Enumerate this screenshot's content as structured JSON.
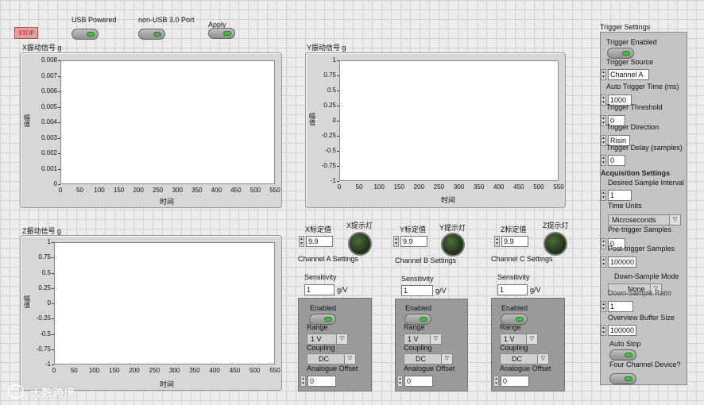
{
  "top": {
    "stop_label": "STOP",
    "usb_powered_label": "USB Powered",
    "non_usb_label": "non-USB 3.0 Port",
    "apply_label": "Apply"
  },
  "charts": {
    "x": {
      "title": "X振动信号 g",
      "ylabel": "幅值",
      "xlabel": "时间",
      "yticks": [
        "0.008",
        "0.007",
        "0.006",
        "0.005",
        "0.004",
        "0.003",
        "0.002",
        "0.001",
        "0"
      ],
      "xticks": [
        "0",
        "50",
        "100",
        "150",
        "200",
        "250",
        "300",
        "350",
        "400",
        "450",
        "500",
        "550"
      ]
    },
    "y": {
      "title": "Y振动信号 g",
      "ylabel": "幅值",
      "xlabel": "时间",
      "yticks": [
        "1",
        "0.75",
        "0.5",
        "0.25",
        "0",
        "-0.25",
        "-0.5",
        "-0.75",
        "-1"
      ],
      "xticks": [
        "0",
        "50",
        "100",
        "150",
        "200",
        "250",
        "300",
        "350",
        "400",
        "450",
        "500",
        "550"
      ]
    },
    "z": {
      "title": "Z振动信号 g",
      "ylabel": "幅值",
      "xlabel": "时间",
      "yticks": [
        "1",
        "0.75",
        "0.5",
        "0.25",
        "0",
        "-0.25",
        "-0.5",
        "-0.75",
        "-1"
      ],
      "xticks": [
        "0",
        "50",
        "100",
        "150",
        "200",
        "250",
        "300",
        "350",
        "400",
        "450",
        "500",
        "550"
      ]
    }
  },
  "chart_data": [
    {
      "type": "line",
      "title": "X振动信号 g",
      "xlabel": "时间",
      "ylabel": "幅值",
      "xlim": [
        0,
        550
      ],
      "ylim": [
        0,
        0.008
      ],
      "series": []
    },
    {
      "type": "line",
      "title": "Y振动信号 g",
      "xlabel": "时间",
      "ylabel": "幅值",
      "xlim": [
        0,
        550
      ],
      "ylim": [
        -1,
        1
      ],
      "series": []
    },
    {
      "type": "line",
      "title": "Z振动信号 g",
      "xlabel": "时间",
      "ylabel": "幅值",
      "xlim": [
        0,
        550
      ],
      "ylim": [
        -1,
        1
      ],
      "series": []
    }
  ],
  "channels": {
    "a": {
      "cal_label": "X标定值",
      "cal_value": "9.9",
      "led_label": "X提示灯",
      "settings_label": "Channel A Settings",
      "sensitivity_label": "Sensitivity",
      "sensitivity_value": "1",
      "sensitivity_unit": "g/V",
      "enabled_label": "Enabled",
      "range_label": "Range",
      "range_value": "1 V",
      "coupling_label": "Coupling",
      "coupling_value": "DC",
      "offset_label": "Analogue Offset",
      "offset_value": "0"
    },
    "b": {
      "cal_label": "Y标定值",
      "cal_value": "9.9",
      "led_label": "Y提示灯",
      "settings_label": "Channel B Settings",
      "sensitivity_label": "Sensitivity",
      "sensitivity_value": "1",
      "sensitivity_unit": "g/V",
      "enabled_label": "Enabled",
      "range_label": "Range",
      "range_value": "1 V",
      "coupling_label": "Coupling",
      "coupling_value": "DC",
      "offset_label": "Analogue Offset",
      "offset_value": "0"
    },
    "c": {
      "cal_label": "Z标定值",
      "cal_value": "9.9",
      "led_label": "Z提示灯",
      "settings_label": "Channel C Settings",
      "sensitivity_label": "Sensitivity",
      "sensitivity_value": "1",
      "sensitivity_unit": "g/V",
      "enabled_label": "Enabled",
      "range_label": "Range",
      "range_value": "1 V",
      "coupling_label": "Coupling",
      "coupling_value": "DC",
      "offset_label": "Analogue Offset",
      "offset_value": "0"
    }
  },
  "trigger": {
    "title": "Trigger Settings",
    "enabled_label": "Trigger Enabled",
    "source_label": "Trigger Source",
    "source_value": "Channel A",
    "auto_time_label": "Auto Trigger Time (ms)",
    "auto_time_value": "1000",
    "threshold_label": "Trigger Threshold",
    "threshold_value": "0",
    "direction_label": "Trigger Direction",
    "direction_value": "Risin",
    "delay_label": "Trigger Delay (samples)",
    "delay_value": "0"
  },
  "acquisition": {
    "title": "Acquisition Settings",
    "sample_interval_label": "Desired Sample Interval",
    "sample_interval_value": "1",
    "time_units_label": "Time Units",
    "time_units_value": "Microseconds",
    "pre_trigger_label": "Pre-trigger Samples",
    "pre_trigger_value": "0",
    "post_trigger_label": "Post-trigger Samples",
    "post_trigger_value": "100000",
    "downsample_mode_label": "Down-Sample Mode",
    "downsample_mode_value": "None",
    "downsample_ratio_label": "Down-Sample Ratio",
    "downsample_ratio_value": "1",
    "overview_label": "Overview Buffer Size",
    "overview_value": "100000",
    "auto_stop_label": "Auto Stop",
    "four_channel_label": "Four Channel Device?"
  },
  "watermark": "大数跨境"
}
